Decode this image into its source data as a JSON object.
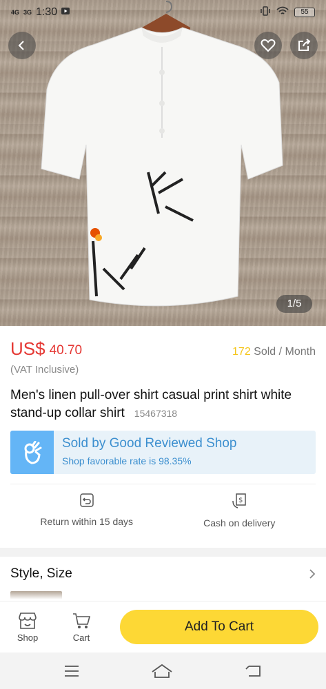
{
  "status_bar": {
    "network": "4G",
    "network2": "3G",
    "time": "1:30",
    "battery": "55"
  },
  "gallery": {
    "counter": "1/5"
  },
  "product": {
    "currency": "US$",
    "price": "40.70",
    "sold_count": "172",
    "sold_suffix": "Sold / Month",
    "vat": "(VAT Inclusive)",
    "title": "Men's linen pull-over shirt casual print shirt white stand-up collar shirt",
    "sku": "15467318"
  },
  "shop": {
    "headline": "Sold by Good Reviewed Shop",
    "rate": "Shop favorable rate is 98.35%"
  },
  "services": [
    {
      "label": "Return within 15 days",
      "icon": "return-icon"
    },
    {
      "label": "Cash on delivery",
      "icon": "cash-icon"
    }
  ],
  "style_section": {
    "label": "Style, Size"
  },
  "action_bar": {
    "shop_label": "Shop",
    "cart_label": "Cart",
    "add_to_cart": "Add To Cart"
  },
  "colors": {
    "price": "#e53935",
    "accent_yellow": "#fdd835",
    "shop_blue": "#3c8fcf"
  }
}
